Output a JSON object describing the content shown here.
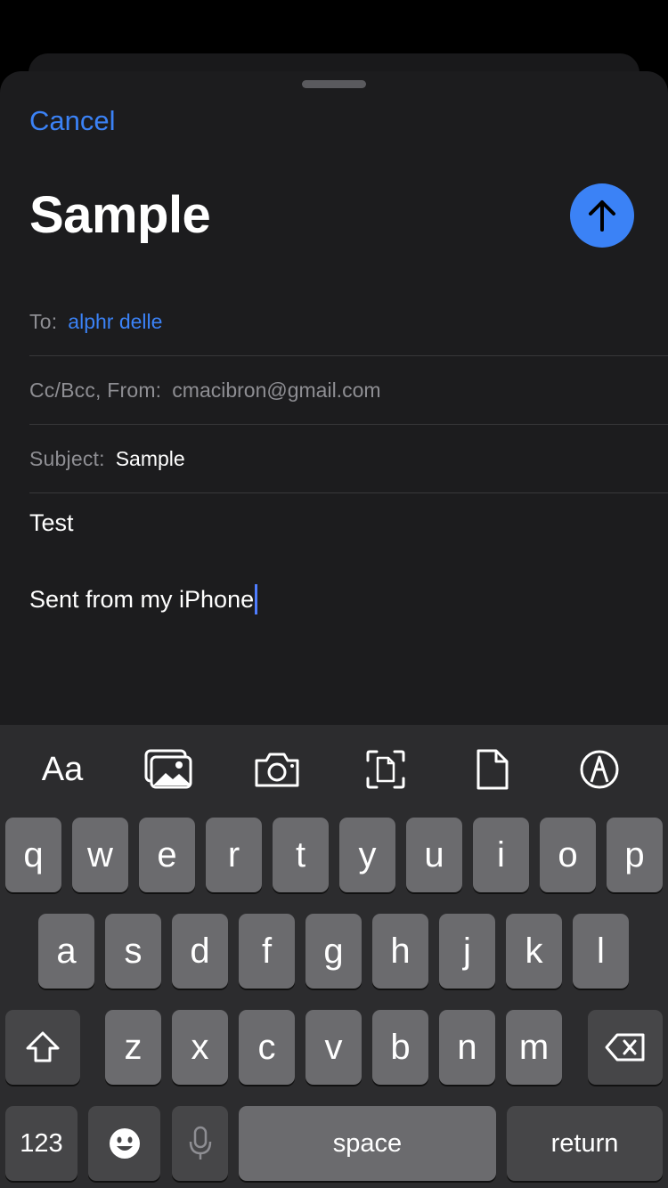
{
  "compose": {
    "cancel_label": "Cancel",
    "title": "Sample",
    "to_label": "To:",
    "to_value": "alphr delle",
    "ccbcc_label": "Cc/Bcc, From:",
    "from_value": "cmacibron@gmail.com",
    "subject_label": "Subject:",
    "subject_value": "Sample",
    "body_line1": "Test",
    "body_line2": "Sent from my iPhone",
    "accent": "#3b82f6"
  },
  "toolbar": {
    "format_label": "Aa",
    "icons": [
      "photo-library-icon",
      "camera-icon",
      "scan-document-icon",
      "attach-file-icon",
      "markup-icon"
    ]
  },
  "keyboard": {
    "row1": [
      "q",
      "w",
      "e",
      "r",
      "t",
      "y",
      "u",
      "i",
      "o",
      "p"
    ],
    "row2": [
      "a",
      "s",
      "d",
      "f",
      "g",
      "h",
      "j",
      "k",
      "l"
    ],
    "row3": [
      "z",
      "x",
      "c",
      "v",
      "b",
      "n",
      "m"
    ],
    "numbers_label": "123",
    "space_label": "space",
    "return_label": "return"
  }
}
